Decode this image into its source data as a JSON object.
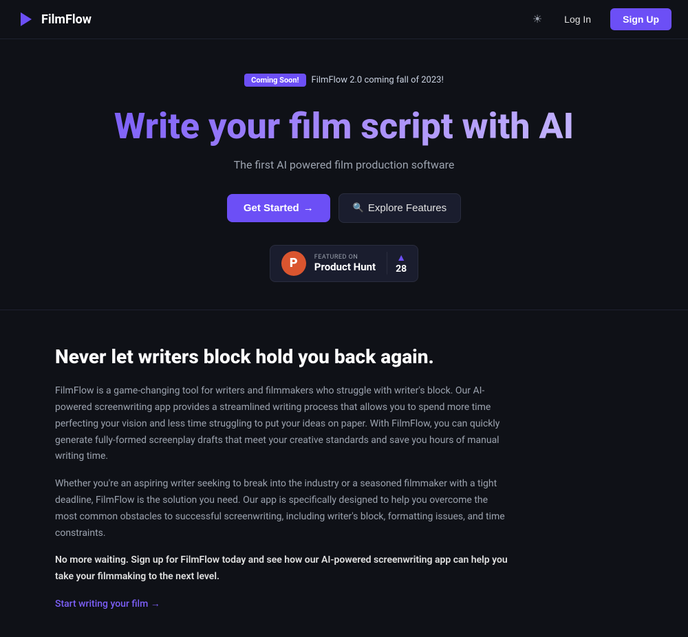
{
  "brand": {
    "name": "FilmFlow",
    "icon_symbol": "▶"
  },
  "navbar": {
    "theme_toggle_icon": "☀",
    "login_label": "Log In",
    "signup_label": "Sign Up"
  },
  "hero": {
    "badge_label": "Coming Soon!",
    "banner_text": "FilmFlow 2.0 coming fall of 2023!",
    "title": "Write your film script with AI",
    "subtitle": "The first AI powered film production software",
    "get_started_label": "Get Started",
    "explore_label": "Explore Features",
    "explore_icon": "🔍"
  },
  "product_hunt": {
    "featured_text": "FEATURED ON",
    "name": "Product Hunt",
    "vote_count": "28",
    "logo_letter": "P"
  },
  "content": {
    "heading": "Never let writers block hold you back again.",
    "para1": "FilmFlow is a game-changing tool for writers and filmmakers who struggle with writer's block. Our AI-powered screenwriting app provides a streamlined writing process that allows you to spend more time perfecting your vision and less time struggling to put your ideas on paper. With FilmFlow, you can quickly generate fully-formed screenplay drafts that meet your creative standards and save you hours of manual writing time.",
    "para2": "Whether you're an aspiring writer seeking to break into the industry or a seasoned filmmaker with a tight deadline, FilmFlow is the solution you need. Our app is specifically designed to help you overcome the most common obstacles to successful screenwriting, including writer's block, formatting issues, and time constraints.",
    "para3_bold": "No more waiting. Sign up for FilmFlow today and see how our AI-powered screenwriting app can help you take your filmmaking to the next level.",
    "cta_link": "Start writing your film →"
  }
}
